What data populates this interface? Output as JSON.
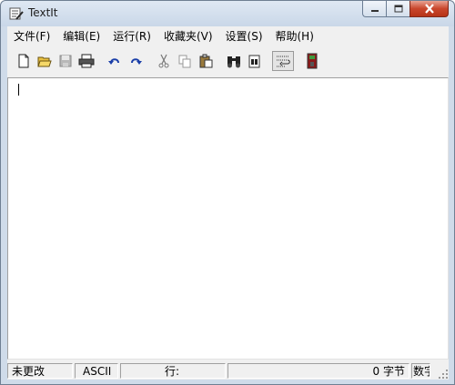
{
  "window": {
    "title": "TextIt"
  },
  "menu": [
    {
      "label": "文件(F)"
    },
    {
      "label": "编辑(E)"
    },
    {
      "label": "运行(R)"
    },
    {
      "label": "收藏夹(V)"
    },
    {
      "label": "设置(S)"
    },
    {
      "label": "帮助(H)"
    }
  ],
  "toolbar_icons": [
    "new-file-icon",
    "open-folder-icon",
    "save-icon",
    "print-icon",
    "undo-icon",
    "redo-icon",
    "cut-icon",
    "copy-icon",
    "paste-icon",
    "find-icon",
    "find-replace-icon",
    "word-wrap-icon",
    "run-icon"
  ],
  "status": {
    "modified": "未更改",
    "encoding": "ASCII",
    "line": "行:",
    "bytes": "0 字节",
    "mode": "数字"
  },
  "colors": {
    "close_button": "#c9462c",
    "titlebar": "#dfe8f3",
    "client": "#f0f0f0"
  }
}
